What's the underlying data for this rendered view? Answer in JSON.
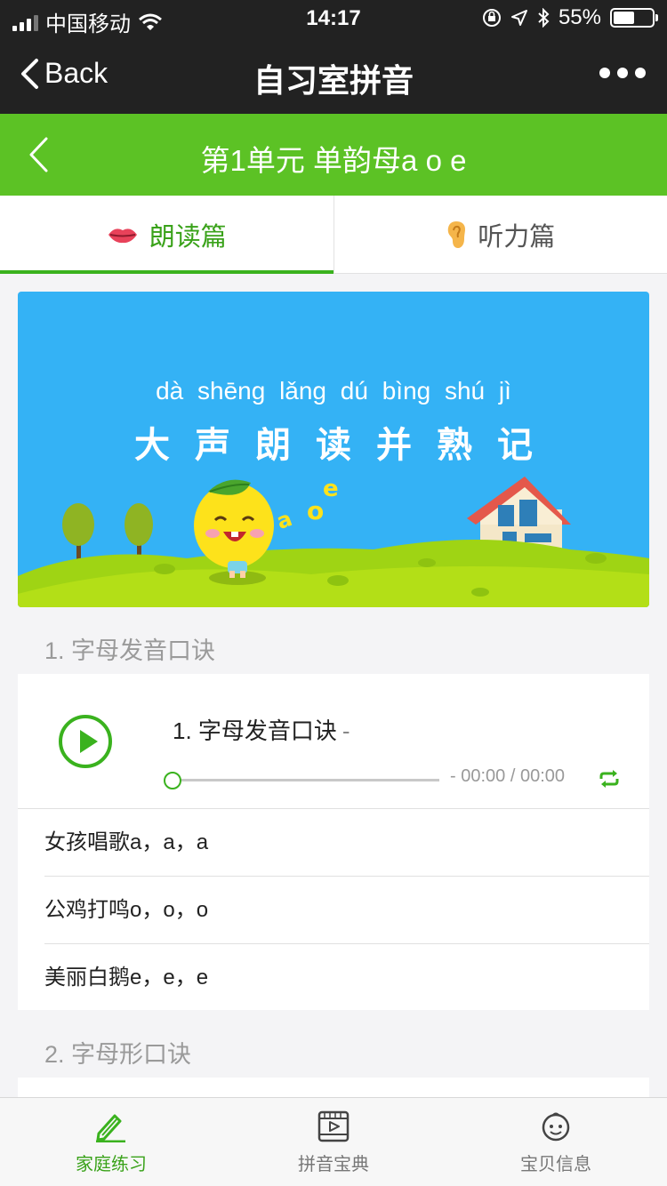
{
  "status_bar": {
    "carrier": "中国移动",
    "time": "14:17",
    "battery": "55%",
    "battery_level": 0.55
  },
  "navbar": {
    "back_label": "Back",
    "title": "自习室拼音"
  },
  "unit_header": {
    "title": "第1单元 单韵母a o e"
  },
  "tabs": [
    {
      "label": "朗读篇",
      "icon": "lips-icon",
      "active": true
    },
    {
      "label": "听力篇",
      "icon": "ear-icon",
      "active": false
    }
  ],
  "banner": {
    "pinyin": "dà shēng lǎng dú bìng shú jì",
    "headline": "大声朗读并熟记",
    "letters": [
      "a",
      "o",
      "e"
    ]
  },
  "sections": [
    {
      "title": "1. 字母发音口诀",
      "player": {
        "track_title": "1. 字母发音口诀",
        "track_suffix": "-",
        "time_prefix": "-",
        "time": "00:00 / 00:00",
        "progress": 0
      },
      "rows": [
        "女孩唱歌a，a，a",
        "公鸡打鸣o，o，o",
        "美丽白鹅e，e，e"
      ]
    },
    {
      "title": "2. 字母形口诀"
    }
  ],
  "tabbar": [
    {
      "label": "家庭练习",
      "icon": "pencil-icon",
      "active": true
    },
    {
      "label": "拼音宝典",
      "icon": "video-book-icon",
      "active": false
    },
    {
      "label": "宝贝信息",
      "icon": "baby-face-icon",
      "active": false
    }
  ],
  "colors": {
    "accent": "#3ab21e",
    "header_green": "#5cc225",
    "banner_sky": "#34b2f5",
    "topbar": "#222222"
  }
}
